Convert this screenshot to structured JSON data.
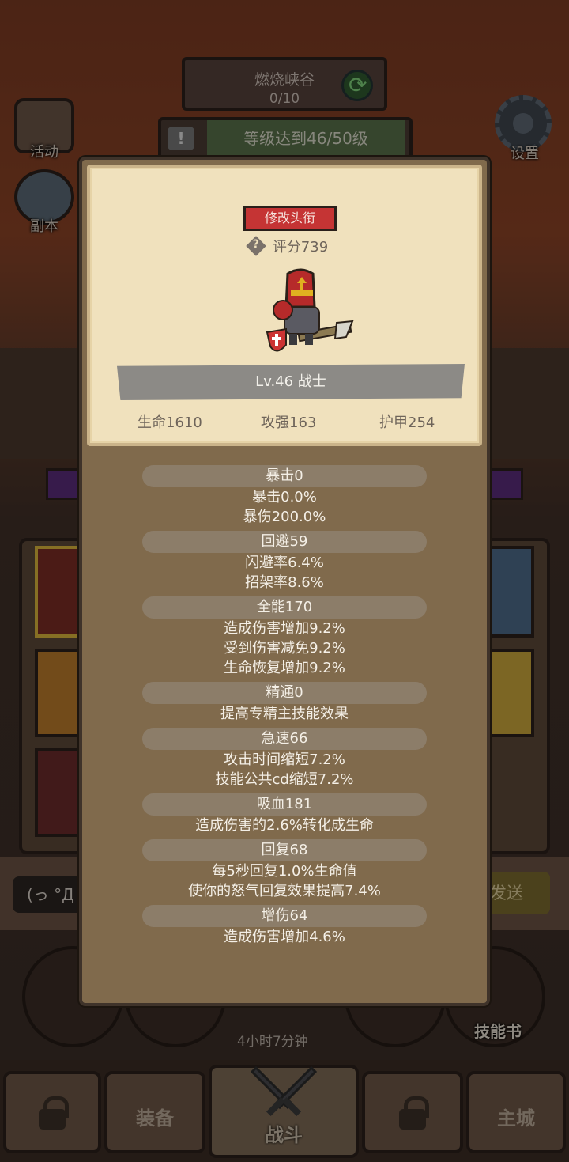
{
  "background": {
    "top_panel": {
      "title": "燃烧峡谷",
      "progress": "0/10"
    },
    "level_requirement": "等级达到46/50级",
    "side_buttons": {
      "event": "活动",
      "dungeon": "副本",
      "settings": "设置"
    },
    "chat_text": "(っ °Д °",
    "send_label": "发送",
    "timer": "4小时7分钟",
    "skill_book": "技能书"
  },
  "nav": {
    "equipment": "装备",
    "battle": "战斗",
    "main_city": "主城"
  },
  "card": {
    "rename_button": "修改头衔",
    "score": "评分739",
    "level_class": "Lv.46 战士",
    "stats": {
      "hp": "生命1610",
      "attack": "攻强163",
      "armor": "护甲254"
    }
  },
  "attributes": [
    {
      "header": "暴击0",
      "lines": [
        "暴击0.0%",
        "暴伤200.0%"
      ]
    },
    {
      "header": "回避59",
      "lines": [
        "闪避率6.4%",
        "招架率8.6%"
      ]
    },
    {
      "header": "全能170",
      "lines": [
        "造成伤害增加9.2%",
        "受到伤害减免9.2%",
        "生命恢复增加9.2%"
      ]
    },
    {
      "header": "精通0",
      "lines": [
        "提高专精主技能效果"
      ]
    },
    {
      "header": "急速66",
      "lines": [
        "攻击时间缩短7.2%",
        "技能公共cd缩短7.2%"
      ]
    },
    {
      "header": "吸血181",
      "lines": [
        "造成伤害的2.6%转化成生命"
      ]
    },
    {
      "header": "回复68",
      "lines": [
        "每5秒回复1.0%生命值",
        "使你的怒气回复效果提高7.4%"
      ]
    },
    {
      "header": "增伤64",
      "lines": [
        "造成伤害增加4.6%"
      ]
    }
  ],
  "colors": {
    "modal_bg": "#806a4c",
    "card_bg": "#f0e1bd",
    "rename_red": "#c53434"
  }
}
